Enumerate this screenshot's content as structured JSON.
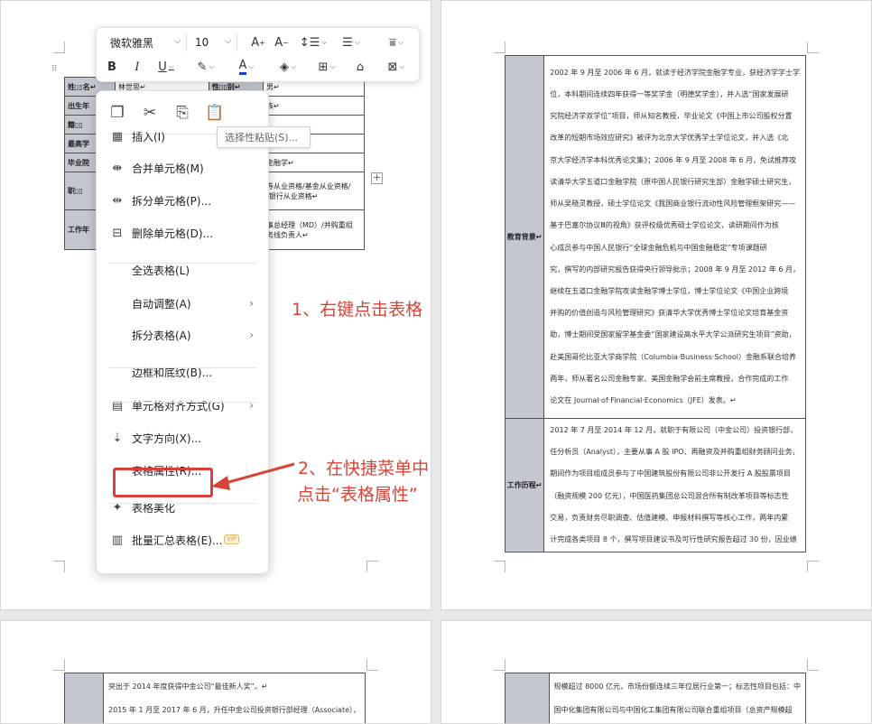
{
  "toolbar": {
    "font_name": "微软雅黑",
    "font_size": "10"
  },
  "tooltip": {
    "text": "选择性粘贴(S)..."
  },
  "context_menu": {
    "items": [
      {
        "label": "插入(I)",
        "icon": "insert-table-icon",
        "submenu": true
      },
      {
        "label": "合并单元格(M)",
        "icon": "merge-cells-icon"
      },
      {
        "label": "拆分单元格(P)...",
        "icon": "split-cells-icon"
      },
      {
        "label": "删除单元格(D)...",
        "icon": "delete-cells-icon"
      },
      {
        "label": "全选表格(L)"
      },
      {
        "label": "自动调整(A)",
        "submenu": true
      },
      {
        "label": "拆分表格(A)",
        "submenu": true
      },
      {
        "label": "边框和底纹(B)..."
      },
      {
        "label": "单元格对齐方式(G)",
        "icon": "cell-align-icon",
        "submenu": true
      },
      {
        "label": "文字方向(X)...",
        "icon": "text-direction-icon"
      },
      {
        "label": "表格属性(R)...",
        "highlighted": true
      },
      {
        "label": "表格美化",
        "icon": "table-beautify-icon"
      },
      {
        "label": "批量汇总表格(E)...",
        "icon": "batch-summary-icon",
        "badge": "VIP"
      }
    ]
  },
  "annotations": {
    "step1": "1、右键点击表格",
    "step2_line1": "2、在快捷菜单中",
    "step2_line2": "点击“表格属性”",
    "color": "#d64536"
  },
  "left_table": {
    "rows": [
      {
        "label": "姓▯▯名↵",
        "value": "林世思↵",
        "label2": "性▯▯别↵",
        "value2": "男↵"
      },
      {
        "label": "出生年",
        "value": "",
        "label2": "",
        "value2": "族↵"
      },
      {
        "label": "籍▯▯",
        "value": "",
        "label2": "",
        "value2": ""
      },
      {
        "label": "最高学",
        "value": "",
        "label2": "",
        "value2": "硕博士↵"
      },
      {
        "label": "毕业院",
        "value": "",
        "label2": "",
        "value2": "金融学↵"
      },
      {
        "label": "职▯▯",
        "value": "",
        "label2": "",
        "value2": "券从业资格/基金从业资格/\n|银行从业资格↵"
      },
      {
        "label": "工作年",
        "value": "",
        "label2": "",
        "value2": "事总经理（MD）/并购重组\n务线负责人↵"
      }
    ]
  },
  "right_table": {
    "education_label": "教育背景↵",
    "education_lines": [
      "2002 年 9 月至 2006 年 6 月，就读于经济学院金融学专业，获经济学学士学",
      "位，本科期间连续四年获得一等奖学金（明德奖学金），并入选“国家发展研",
      "究院经济学双学位”项目，师从知名教授，毕业论文《中国上市公司股权分置",
      "改革的短期市场效应研究》被评为北京大学优秀学士学位论文，并入选《北",
      "京大学经济学本科优秀论文集》；2006 年 9 月至 2008 年 6 月，免试推荐攻",
      "读清华大学五道口金融学院（原中国人民银行研究生部）金融学硕士研究生，",
      "师从吴晓灵教授，硕士学位论文《我国商业银行流动性风险管理框架研究——",
      "基于巴塞尔协议Ⅲ的视角》获评校级优秀硕士学位论文，读研期间作为核",
      "心成员参与中国人民银行“全球金融危机与中国金融稳定”专项课题研",
      "究，撰写的内部研究报告获得央行领导批示；2008 年 9 月至 2012 年 6 月，",
      "继续在五道口金融学院攻读金融学博士学位，博士学位论文《中国企业跨境",
      "并购的价值创造与风险管理研究》获清华大学优秀博士学位论文培育基金资",
      "助，博士期间受国家留学基金委“国家建设高水平大学公派研究生项目”资助，",
      "赴美国哥伦比亚大学商学院（Columbia·Business·School）金融系联合培养",
      "两年，师从著名公司金融专家、美国金融学会前主席教授，合作完成的工作",
      "论文在 Journal·of·Financial·Economics（JFE）发表。↵"
    ],
    "work_label": "工作历程↵",
    "work_lines": [
      "2012 年 7 月至 2014 年 12 月，就职于有限公司（中金公司）投资银行部，",
      "任分析员（Analyst），主要从事 A 股 IPO、再融资及并购重组财务顾问业务，",
      "期间作为项目组成员参与了中国建筑股份有限公司非公开发行 A 股股票项目",
      "（融资规模 200 亿元），中国医药集团总公司混合所有制改革项目等标志性",
      "交易，负责财务尽职调查、估值建模、申报材料撰写等核心工作，两年内累",
      "计完成各类项目 8 个，撰写项目建议书及可行性研究报告超过 30 份，因业绩"
    ]
  },
  "bottom_left": {
    "lines": [
      "突出于 2014 年度获得中金公司“最佳新人奖”。↵",
      "2015 年 1 月至 2017 年 6 月，升任中金公司投资银行部经理（Associate），"
    ]
  },
  "bottom_right": {
    "lines": [
      "规模超过 8000 亿元，市场份额连续三年位居行业第一；标志性项目包括：中",
      "国中化集团有限公司与中国化工集团有限公司联合重组项目（总资产规模超"
    ]
  }
}
